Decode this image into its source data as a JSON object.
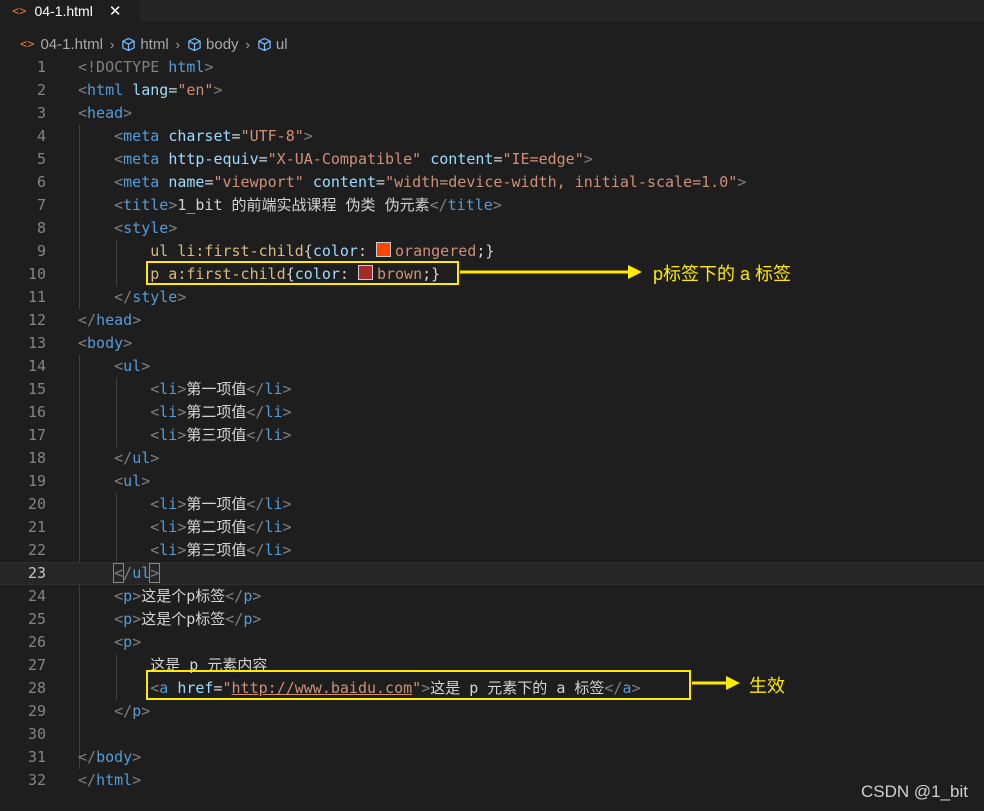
{
  "tab": {
    "file_icon": "<>",
    "name": "04-1.html",
    "close": "✕"
  },
  "breadcrumb": {
    "file": "04-1.html",
    "items": [
      "html",
      "body",
      "ul"
    ],
    "sep": "›"
  },
  "line_numbers": [
    "1",
    "2",
    "3",
    "4",
    "5",
    "6",
    "7",
    "8",
    "9",
    "10",
    "11",
    "12",
    "13",
    "14",
    "15",
    "16",
    "17",
    "18",
    "19",
    "20",
    "21",
    "22",
    "23",
    "24",
    "25",
    "26",
    "27",
    "28",
    "29",
    "30",
    "31",
    "32"
  ],
  "code": {
    "l1_doctype": "<!DOCTYPE",
    "l1_html": " html",
    "l1_close": ">",
    "l2_html": "html",
    "l2_attr": "lang",
    "l2_val": "\"en\"",
    "l3_head": "head",
    "l4_meta": "meta",
    "l4_attr": "charset",
    "l4_val": "\"UTF-8\"",
    "l5_meta": "meta",
    "l5_attr1": "http-equiv",
    "l5_val1": "\"X-UA-Compatible\"",
    "l5_attr2": "content",
    "l5_val2": "\"IE=edge\"",
    "l6_meta": "meta",
    "l6_attr1": "name",
    "l6_val1": "\"viewport\"",
    "l6_attr2": "content",
    "l6_val2": "\"width=device-width, initial-scale=1.0\"",
    "l7_tag": "title",
    "l7_text": "1_bit 的前端实战课程 伪类 伪元素",
    "l8_tag": "style",
    "l9_sel": "ul li:first-child",
    "l9_prop": "color",
    "l9_color": "#ff4500",
    "l9_val": "orangered",
    "l10_sel": "p a:first-child",
    "l10_prop": "color",
    "l10_color": "#a52a2a",
    "l10_val": "brown",
    "l11_tag": "style",
    "l12_tag": "head",
    "l13_tag": "body",
    "ul": "ul",
    "li": "li",
    "items": [
      "第一项值",
      "第二项值",
      "第三项值"
    ],
    "p": "p",
    "l24_text": "这是个p标签",
    "l25_text": "这是个p标签",
    "l27_text": "这是 p 元素内容",
    "l28_a": "a",
    "l28_attr": "href",
    "l28_url": "http://www.baidu.com",
    "l28_text": "这是 p 元素下的 a 标签",
    "l31_tag": "body",
    "l32_tag": "html"
  },
  "annotations": {
    "note1": "p标签下的 a 标签",
    "note2": "生效",
    "highlight_color": "#ffea00"
  },
  "watermark": "CSDN @1_bit"
}
